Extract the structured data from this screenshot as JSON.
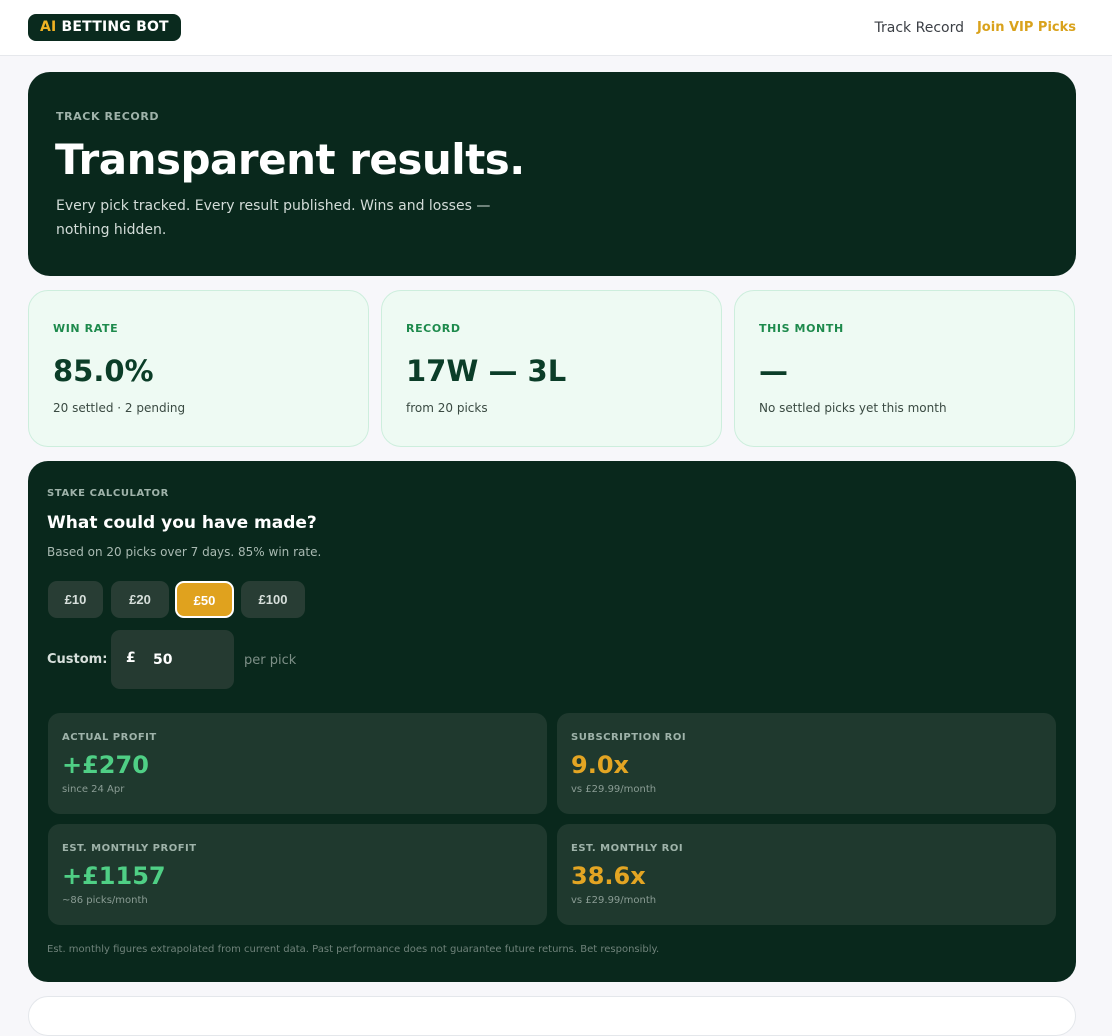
{
  "header": {
    "logo_ai": "AI",
    "logo_rest": " BETTING BOT",
    "nav_track": "Track Record",
    "nav_vip": "Join VIP Picks"
  },
  "hero": {
    "eyebrow": "TRACK RECORD",
    "title": "Transparent results.",
    "subtitle": "Every pick tracked. Every result published. Wins and losses — nothing hidden."
  },
  "stats": [
    {
      "label": "WIN RATE",
      "value": "85.0%",
      "sub": "20 settled · 2 pending"
    },
    {
      "label": "RECORD",
      "value": "17W — 3L",
      "sub": "from 20 picks"
    },
    {
      "label": "THIS MONTH",
      "value": "—",
      "sub": "No settled picks yet this month"
    }
  ],
  "calculator": {
    "eyebrow": "STAKE CALCULATOR",
    "title": "What could you have made?",
    "subtitle": "Based on 20 picks over 7 days. 85% win rate.",
    "stakes": [
      "£10",
      "£20",
      "£50",
      "£100"
    ],
    "selected_stake": "£50",
    "custom_label": "Custom:",
    "currency": "£",
    "custom_value": "50",
    "per_pick": "per pick",
    "results": [
      {
        "label": "ACTUAL PROFIT",
        "value": "+£270",
        "sub": "since 24 Apr"
      },
      {
        "label": "SUBSCRIPTION ROI",
        "value": "9.0x",
        "sub": "vs £29.99/month"
      },
      {
        "label": "EST. MONTHLY PROFIT",
        "value": "+£1157",
        "sub": "~86 picks/month"
      },
      {
        "label": "EST. MONTHLY ROI",
        "value": "38.6x",
        "sub": "vs £29.99/month"
      }
    ],
    "disclaimer": "Est. monthly figures extrapolated from current data. Past performance does not guarantee future returns. Bet responsibly."
  },
  "colors": {
    "dark_green": "#09281c",
    "accent_gold": "#e0a21e",
    "profit_green": "#4fcf85"
  }
}
